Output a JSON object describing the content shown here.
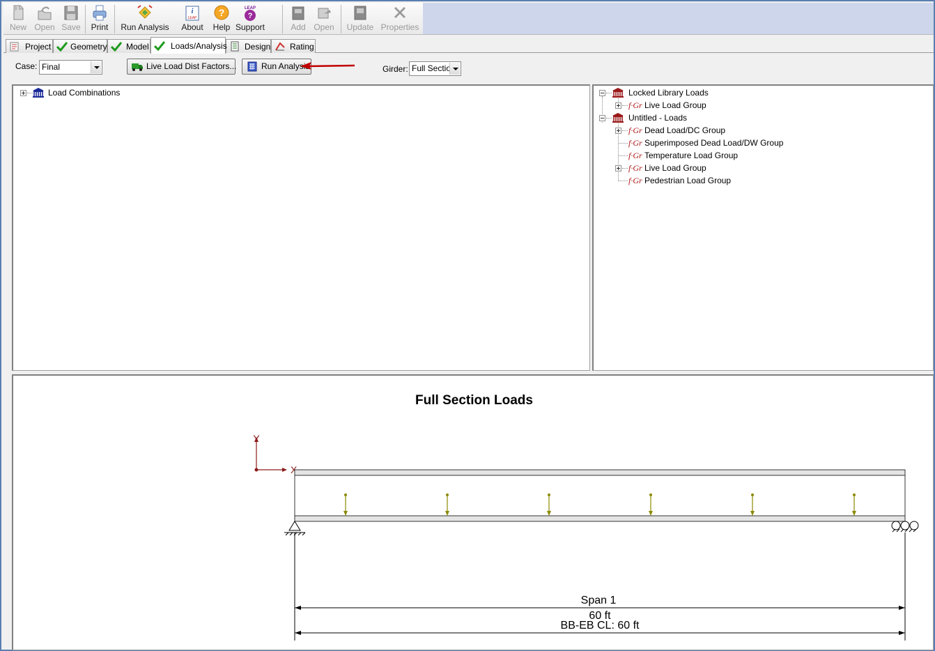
{
  "toolbar": {
    "new": "New",
    "open": "Open",
    "save": "Save",
    "print": "Print",
    "run_analysis": "Run Analysis",
    "about": "About",
    "help": "Help",
    "support": "Support",
    "add": "Add",
    "open2": "Open",
    "update": "Update",
    "properties": "Properties",
    "about_icon_text": "LEAP",
    "support_icon_text": "LEAP"
  },
  "tabs": [
    {
      "label": "Project",
      "icon": "project-icon"
    },
    {
      "label": "Geometry",
      "icon": "checkmark-icon"
    },
    {
      "label": "Model",
      "icon": "checkmark-icon"
    },
    {
      "label": "Loads/Analysis",
      "icon": "checkmark-icon",
      "active": true
    },
    {
      "label": "Design",
      "icon": "design-icon"
    },
    {
      "label": "Rating",
      "icon": "rating-icon"
    }
  ],
  "controls": {
    "case_label": "Case:",
    "case_value": "Final",
    "live_load_button": "Live Load Dist Factors...",
    "run_analysis_button": "Run Analysis",
    "girder_label": "Girder:",
    "girder_value": "Full Section"
  },
  "left_tree": {
    "root": "Load Combinations"
  },
  "right_tree": {
    "locked": "Locked Library Loads",
    "locked_children": [
      "Live Load Group"
    ],
    "untitled": "Untitled - Loads",
    "untitled_children": [
      "Dead Load/DC Group",
      "Superimposed Dead Load/DW Group",
      "Temperature Load Group",
      "Live Load Group",
      "Pedestrian Load Group"
    ],
    "group_prefix": "f·Gr"
  },
  "diagram": {
    "title": "Full Section Loads",
    "axis_y": "Y",
    "axis_x": "X",
    "span_label": "Span 1",
    "span_length": "60 ft",
    "overall_label": "BB-EB CL: 60 ft",
    "load_count": 6
  },
  "colors": {
    "accent_border": "#5a7fb0",
    "toolbar_fill": "#cdd6eb",
    "arrow_red": "#c00000",
    "load_arrow": "#8a8a00",
    "check_green": "#1e9b1e"
  }
}
